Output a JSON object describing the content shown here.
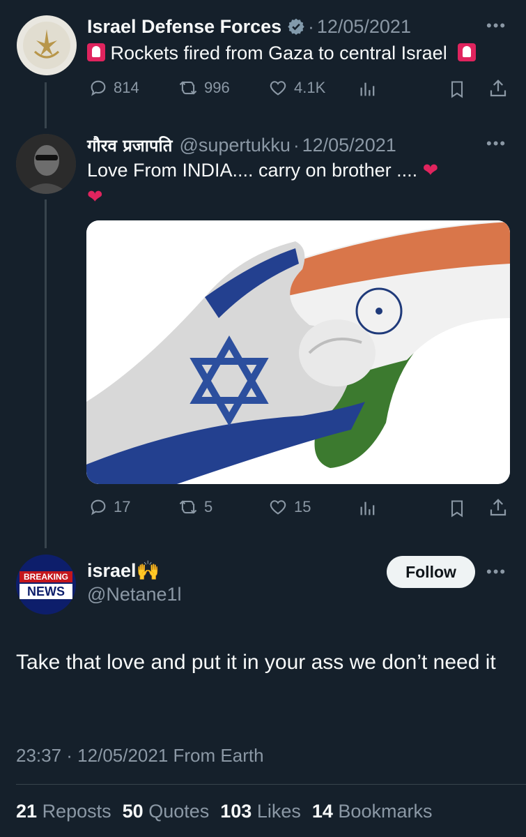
{
  "tweet1": {
    "name": "Israel Defense Forces",
    "date": "12/05/2021",
    "text": "Rockets fired from Gaza to central Israel",
    "replies": "814",
    "reposts": "996",
    "likes": "4.1K"
  },
  "tweet2": {
    "name": "गौरव प्रजापति",
    "handle": "@supertukku",
    "date": "12/05/2021",
    "text": "Love From INDIA....  carry on brother ....",
    "replies": "17",
    "reposts": "5",
    "likes": "15"
  },
  "tweet3": {
    "name": "israel🙌",
    "handle": "@Netane1l",
    "avatar_badge_top": "BREAKING",
    "avatar_badge_bottom": "NEWS",
    "follow_label": "Follow",
    "text": "Take that love and put it in your ass we don’t need it",
    "timestamp": "23:37 · 12/05/2021 From Earth",
    "stats": {
      "reposts_count": "21",
      "reposts_label": "Reposts",
      "quotes_count": "50",
      "quotes_label": "Quotes",
      "likes_count": "103",
      "likes_label": "Likes",
      "bookmarks_count": "14",
      "bookmarks_label": "Bookmarks"
    }
  },
  "colors": {
    "background": "#15202b",
    "muted": "#8b98a5",
    "line": "#38444d",
    "siren": "#e0245e"
  }
}
